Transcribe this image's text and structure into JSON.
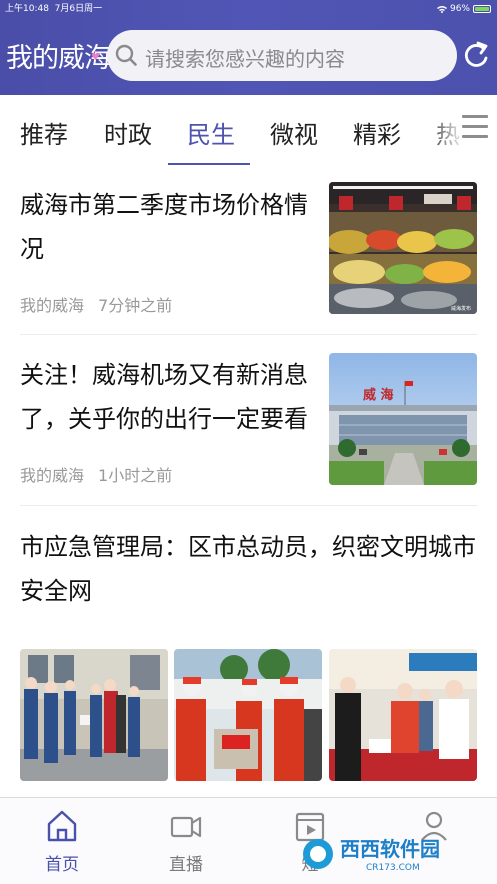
{
  "status_bar": {
    "time": "上午10:48",
    "date": "7月6日周一",
    "battery": "96%"
  },
  "header": {
    "logo_text": "我的威海",
    "search_placeholder": "请搜索您感兴趣的内容"
  },
  "tabs": [
    {
      "label": "推荐"
    },
    {
      "label": "时政"
    },
    {
      "label": "民生",
      "active": true
    },
    {
      "label": "微视"
    },
    {
      "label": "精彩"
    },
    {
      "label": "热"
    }
  ],
  "news": [
    {
      "title_line1": "威海市第二季度市场价格情",
      "title_line2": "况",
      "source": "我的威海",
      "time": "7分钟之前"
    },
    {
      "title_line1": "关注！威海机场又有新消息",
      "title_line2": "了，关乎你的出行一定要看",
      "source": "我的威海",
      "time": "1小时之前"
    },
    {
      "title_line1": "市应急管理局：区市总动员，织密文明城市",
      "title_line2": "安全网"
    }
  ],
  "airport_sign": "威 海",
  "image_watermark": "威海发布",
  "bottom_nav": [
    {
      "label": "首页",
      "icon": "home-icon",
      "active": true
    },
    {
      "label": "直播",
      "icon": "video-camera-icon"
    },
    {
      "label": "短",
      "icon": "film-icon"
    },
    {
      "label": "",
      "icon": "user-icon"
    }
  ],
  "watermark_overlay": "西西软件园 CR173.COM",
  "colors": {
    "brand": "#4d53ae",
    "header": "#5156b6",
    "accent_pink": "#f07cc4"
  }
}
